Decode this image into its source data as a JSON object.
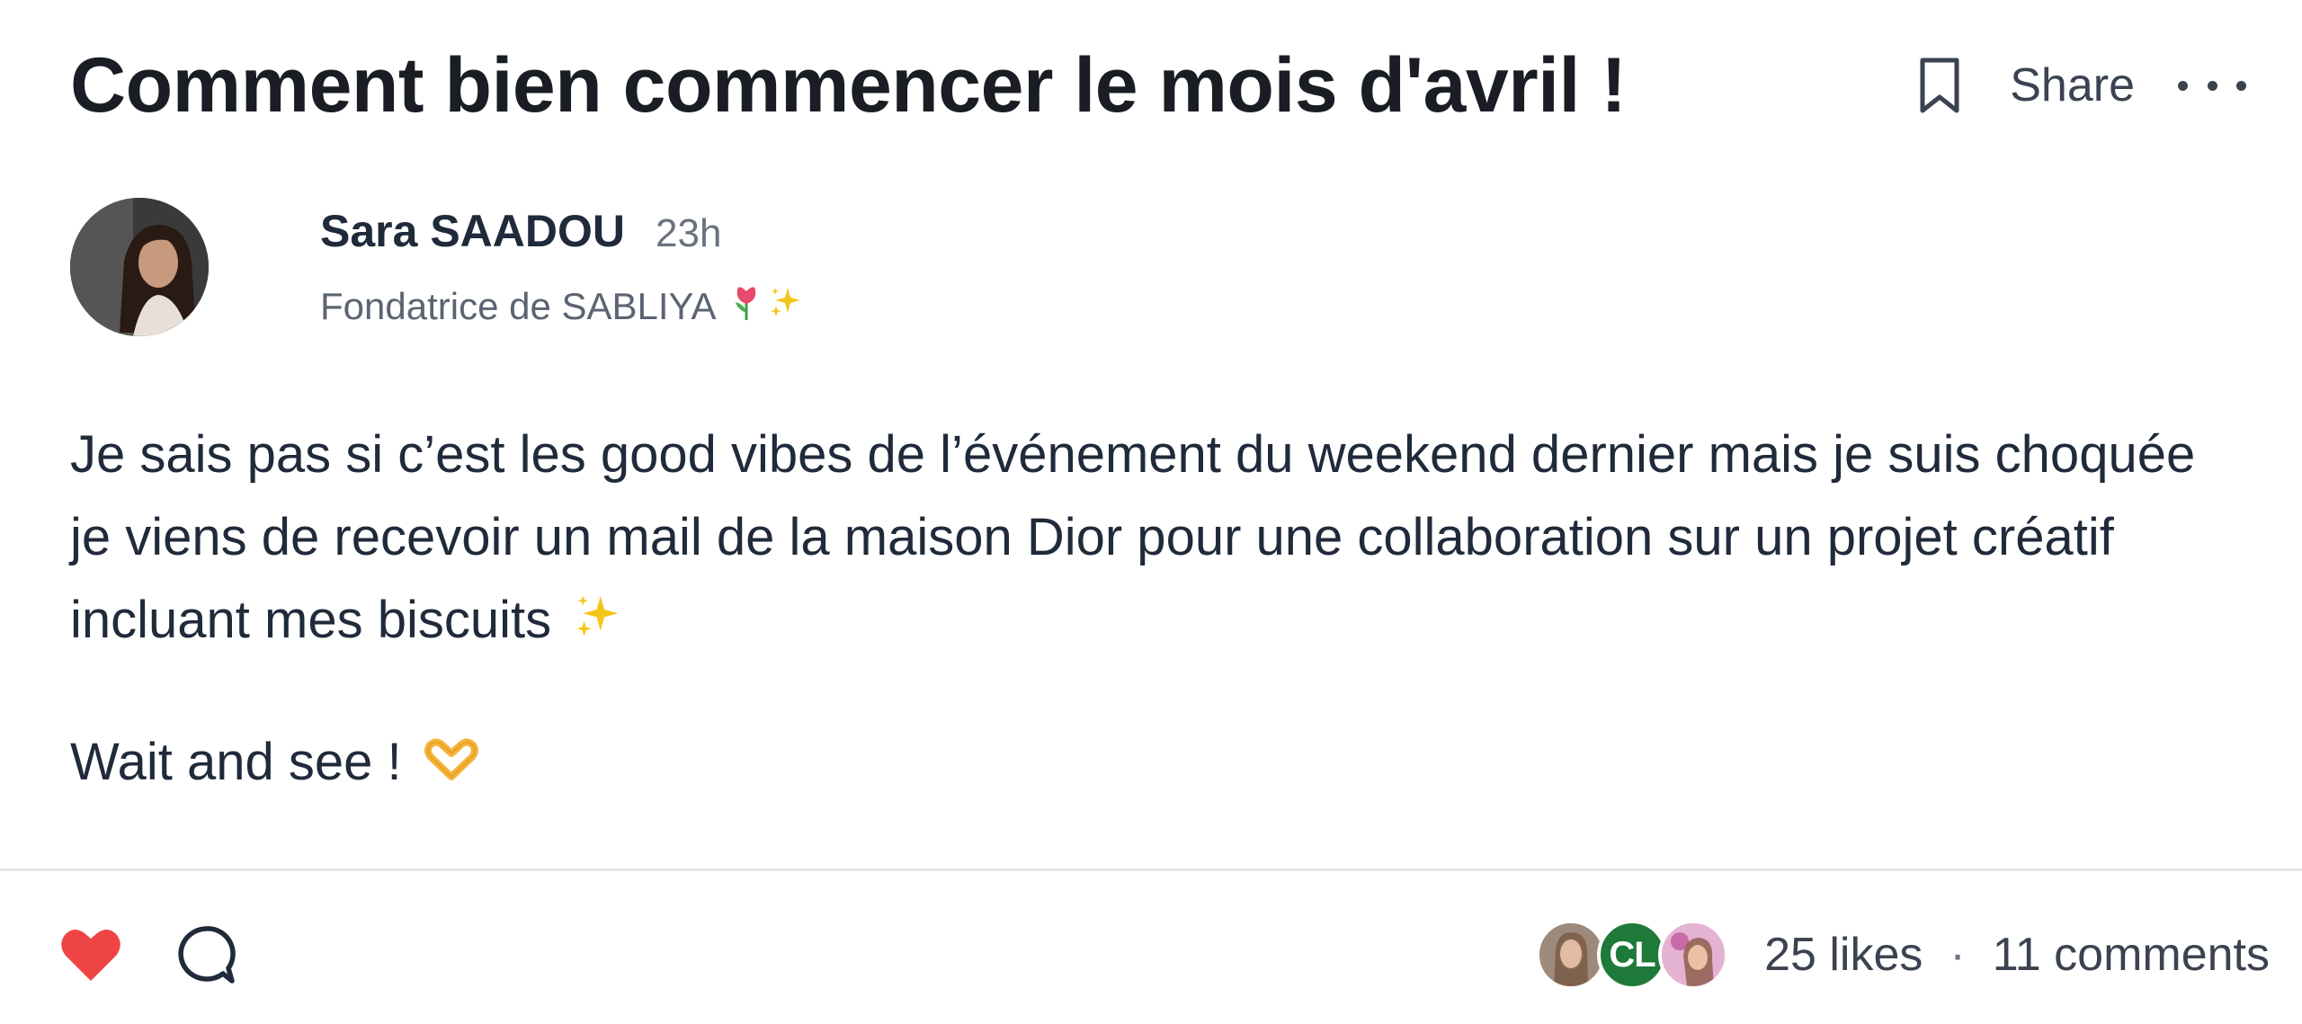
{
  "post": {
    "title": "Comment bien commencer le mois d'avril !",
    "actions": {
      "bookmark_icon": "bookmark-icon",
      "share_label": "Share",
      "more_icon": "more-horizontal-icon"
    },
    "author": {
      "name": "Sara SAADOU",
      "time": "23h",
      "role": "Fondatrice de SABLIYA",
      "role_emojis": [
        "tulip",
        "sparkles"
      ]
    },
    "body": {
      "paragraph_1": "Je sais pas si c’est les good vibes de l’événement du weekend dernier mais je suis choquée je viens de recevoir un mail de la maison Dior pour une collaboration sur un projet créatif incluant mes biscuits",
      "paragraph_1_emoji": "sparkles",
      "paragraph_2": "Wait and see !",
      "paragraph_2_emoji": "heart-hands"
    },
    "footer": {
      "like_icon": "heart-icon",
      "like_color": "#ef4444",
      "comment_icon": "comment-bubble-icon",
      "liker_initials": "CL",
      "likes_label": "25 likes",
      "separator": "·",
      "comments_label": "11 comments"
    }
  }
}
